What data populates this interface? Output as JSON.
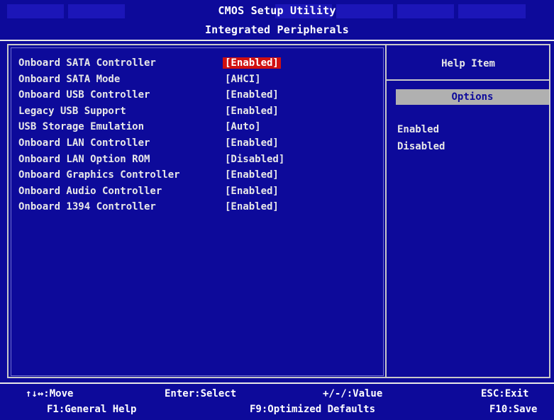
{
  "header": {
    "title": "CMOS Setup Utility",
    "subtitle": "Integrated Peripherals"
  },
  "settings": [
    {
      "label": "Onboard SATA Controller",
      "value": "[Enabled]",
      "selected": true
    },
    {
      "label": "Onboard SATA Mode",
      "value": "[AHCI]"
    },
    {
      "label": "Onboard USB Controller",
      "value": "[Enabled]"
    },
    {
      "label": "Legacy USB Support",
      "value": "[Enabled]"
    },
    {
      "label": "USB Storage Emulation",
      "value": "[Auto]"
    },
    {
      "label": "Onboard LAN Controller",
      "value": "[Enabled]"
    },
    {
      "label": "Onboard LAN Option ROM",
      "value": "[Disabled]"
    },
    {
      "label": "Onboard Graphics Controller",
      "value": "[Enabled]"
    },
    {
      "label": "Onboard Audio Controller",
      "value": "[Enabled]"
    },
    {
      "label": "Onboard 1394 Controller",
      "value": "[Enabled]"
    }
  ],
  "help": {
    "title": "Help Item",
    "options_header": "Options",
    "options": [
      "Enabled",
      "Disabled"
    ]
  },
  "footer": {
    "move": "↑↓↔:Move",
    "select": "Enter:Select",
    "value": "+/-/:Value",
    "exit": "ESC:Exit",
    "general_help": "F1:General Help",
    "optimized": "F9:Optimized Defaults",
    "save": "F10:Save"
  },
  "colors": {
    "background": "#0d0a9a",
    "selection": "#d01010",
    "options_box": "#b0b0b0"
  }
}
